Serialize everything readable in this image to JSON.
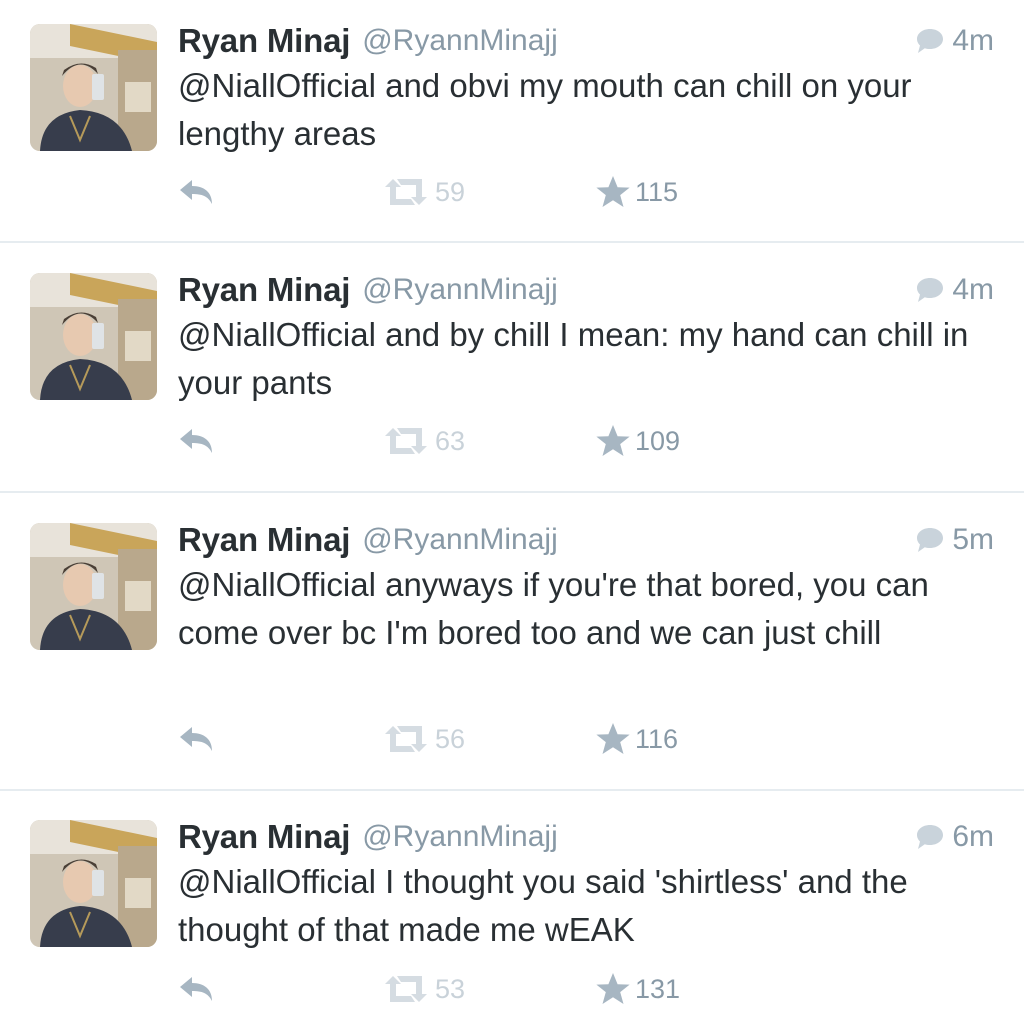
{
  "colors": {
    "text": "#292f33",
    "secondary": "#8899a6",
    "retweet_icon": "#d5dce2",
    "divider": "#e6ecf0"
  },
  "tweets": [
    {
      "name": "Ryan Minaj",
      "handle": "@RyannMinajj",
      "time": "4m",
      "text": "@NiallOfficial and obvi my mouth can chill on your lengthy areas",
      "retweets": "59",
      "favorites": "115"
    },
    {
      "name": "Ryan Minaj",
      "handle": "@RyannMinajj",
      "time": "4m",
      "text": "@NiallOfficial and by chill I mean: my hand can chill in your pants",
      "retweets": "63",
      "favorites": "109"
    },
    {
      "name": "Ryan Minaj",
      "handle": "@RyannMinajj",
      "time": "5m",
      "text": "@NiallOfficial anyways if you're that bored, you can come over bc I'm bored too and we can just chill",
      "retweets": "56",
      "favorites": "116"
    },
    {
      "name": "Ryan Minaj",
      "handle": "@RyannMinajj",
      "time": "6m",
      "text": "@NiallOfficial I thought you said 'shirtless' and the thought of that made me wEAK",
      "retweets": "53",
      "favorites": "131"
    }
  ],
  "icons": {
    "reply": "reply-icon",
    "retweet": "retweet-icon",
    "favorite": "star-icon",
    "conversation": "speech-bubble-icon"
  }
}
